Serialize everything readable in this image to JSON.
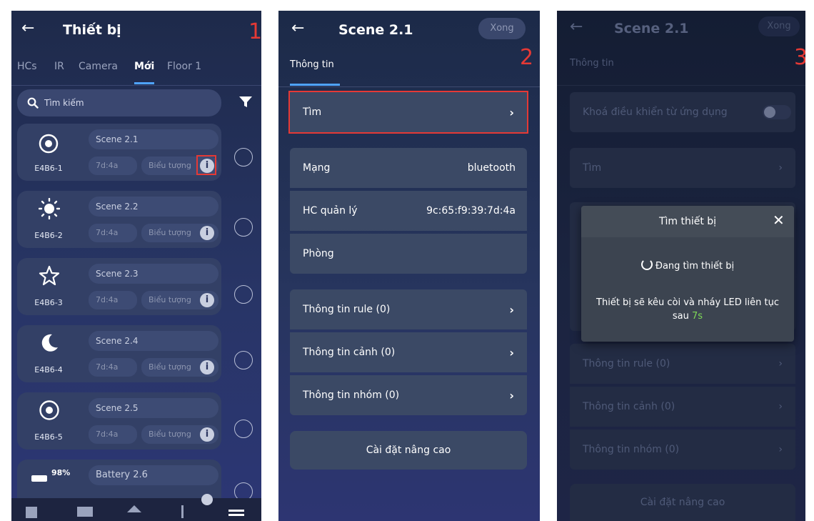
{
  "screen1": {
    "title": "Thiết bị",
    "step_label": "1",
    "tabs": [
      "HCs",
      "IR",
      "Camera",
      "Mới",
      "Floor 1"
    ],
    "search_placeholder": "Tìm kiếm",
    "devices": [
      {
        "icon": "target-icon",
        "id": "E4B6-1",
        "name": "Scene 2.1",
        "addr": "7d:4a",
        "icon_label": "Biểu tượng"
      },
      {
        "icon": "sun-icon",
        "id": "E4B6-2",
        "name": "Scene 2.2",
        "addr": "7d:4a",
        "icon_label": "Biểu tượng"
      },
      {
        "icon": "star-icon",
        "id": "E4B6-3",
        "name": "Scene 2.3",
        "addr": "7d:4a",
        "icon_label": "Biểu tượng"
      },
      {
        "icon": "moon-icon",
        "id": "E4B6-4",
        "name": "Scene 2.4",
        "addr": "7d:4a",
        "icon_label": "Biểu tượng"
      },
      {
        "icon": "record-icon",
        "id": "E4B6-5",
        "name": "Scene 2.5",
        "addr": "7d:4a",
        "icon_label": "Biểu tượng"
      }
    ],
    "battery": {
      "percent": "98%",
      "name": "Battery 2.6"
    },
    "highlight_color": "#e53935"
  },
  "screen2": {
    "title": "Scene 2.1",
    "done_label": "Xong",
    "step_label": "2",
    "tab_label": "Thông tin",
    "find_label": "Tìm",
    "network_label": "Mạng",
    "network_value": "bluetooth",
    "hc_label": "HC quản lý",
    "hc_value": "9c:65:f9:39:7d:4a",
    "room_label": "Phòng",
    "rule_label": "Thông tin rule (0)",
    "scene_label": "Thông tin cảnh (0)",
    "group_label": "Thông tin nhóm (0)",
    "advanced_label": "Cài đặt nâng cao"
  },
  "screen3": {
    "title": "Scene 2.1",
    "done_label": "Xong",
    "step_label": "3",
    "tab_label": "Thông tin",
    "lock_label": "Khoá điều khiển từ ứng dụng",
    "find_label": "Tìm",
    "rule_label": "Thông tin rule (0)",
    "scene_label": "Thông tin cảnh (0)",
    "group_label": "Thông tin nhóm (0)",
    "advanced_label": "Cài đặt nâng cao",
    "dialog": {
      "title": "Tìm thiết bị",
      "status": "Đang tìm thiết bị",
      "message": "Thiết bị sẽ kêu còi và nháy LED liên tục sau",
      "countdown": "7s",
      "countdown_color": "#7ed957"
    }
  }
}
